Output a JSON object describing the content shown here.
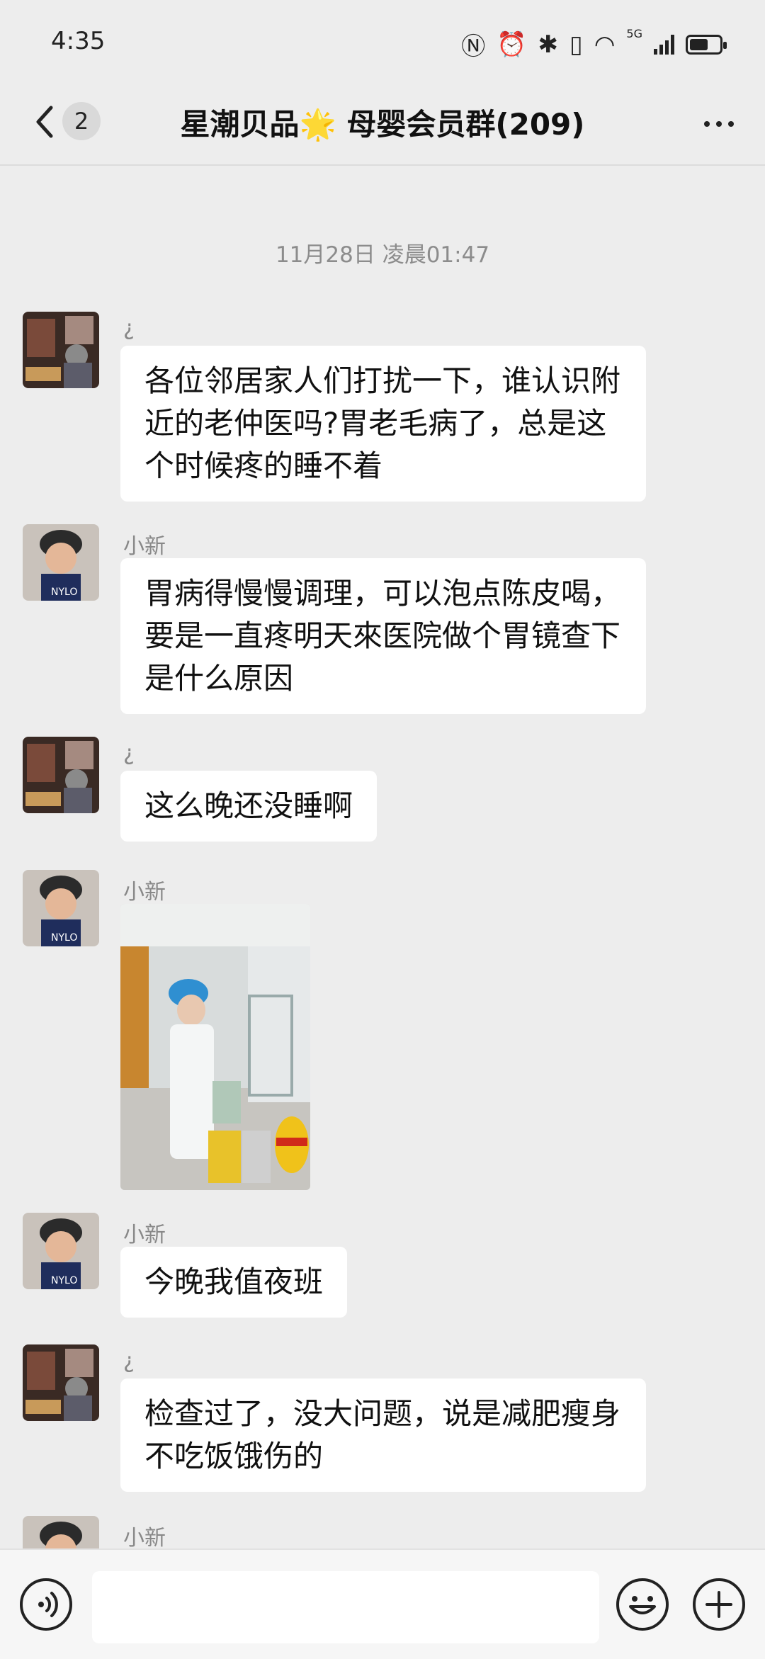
{
  "status_bar": {
    "time": "4:35",
    "network": "5G"
  },
  "header": {
    "unread_count": "2",
    "title": "星潮贝品🌟 母婴会员群(209)"
  },
  "chat": {
    "timestamp": "11月28日 凌晨01:47",
    "messages": [
      {
        "sender": "¿",
        "text": "各位邻居家人们打扰一下，谁认识附近的老仲医吗?胃老毛病了，总是这个时候疼的睡不着"
      },
      {
        "sender": "小新",
        "text": "胃病得慢慢调理，可以泡点陈皮喝，要是一直疼明天來医院做个胃镜查下是什么原因"
      },
      {
        "sender": "¿",
        "text": "这么晚还没睡啊"
      },
      {
        "sender": "小新",
        "image": "hospital-photo"
      },
      {
        "sender": "小新",
        "text": "今晚我值夜班"
      },
      {
        "sender": "¿",
        "text": "检查过了，没大问题，说是减肥瘦身不吃饭饿伤的"
      },
      {
        "sender": "小新"
      }
    ]
  },
  "colors": {
    "background": "#ededed",
    "bubble": "#ffffff",
    "muted_text": "#888888"
  }
}
